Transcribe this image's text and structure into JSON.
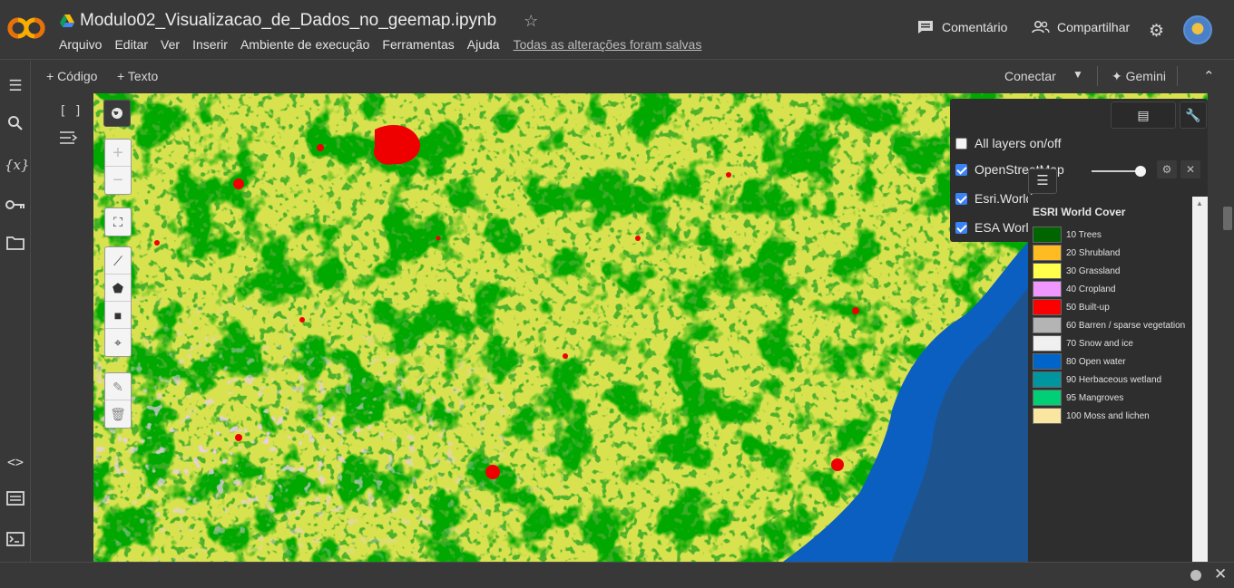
{
  "header": {
    "app_logo": "colab-logo",
    "drive_icon": "google-drive-icon",
    "notebook_title": "Modulo02_Visualizacao_de_Dados_no_geemap.ipynb",
    "menu": [
      "Arquivo",
      "Editar",
      "Ver",
      "Inserir",
      "Ambiente de execução",
      "Ferramentas",
      "Ajuda"
    ],
    "saved_status": "Todas as alterações foram salvas",
    "comment_label": "Comentário",
    "share_label": "Compartilhar"
  },
  "toolbar": {
    "add_code": "+ Código",
    "add_text": "+ Texto",
    "connect": "Conectar",
    "gemini": "Gemini"
  },
  "cell": {
    "run_brackets": "[ ]"
  },
  "map": {
    "layer_panel": {
      "items": [
        {
          "label": "All layers on/off",
          "checked": false
        },
        {
          "label": "OpenStreetMap",
          "checked": true
        },
        {
          "label": "Esri.World",
          "checked": true
        },
        {
          "label": "ESA World",
          "checked": true
        }
      ]
    },
    "legend": {
      "title": "ESRI World Cover",
      "items": [
        {
          "label": "10 Trees",
          "color": "#006400"
        },
        {
          "label": "20 Shrubland",
          "color": "#ffbb22"
        },
        {
          "label": "30 Grassland",
          "color": "#ffff4c"
        },
        {
          "label": "40 Cropland",
          "color": "#f096ff"
        },
        {
          "label": "50 Built-up",
          "color": "#fa0000"
        },
        {
          "label": "60 Barren / sparse vegetation",
          "color": "#b4b4b4"
        },
        {
          "label": "70 Snow and ice",
          "color": "#f0f0f0"
        },
        {
          "label": "80 Open water",
          "color": "#0064c8"
        },
        {
          "label": "90 Herbaceous wetland",
          "color": "#0096a0"
        },
        {
          "label": "95 Mangroves",
          "color": "#00cf75"
        },
        {
          "label": "100 Moss and lichen",
          "color": "#fae6a0"
        }
      ]
    }
  }
}
